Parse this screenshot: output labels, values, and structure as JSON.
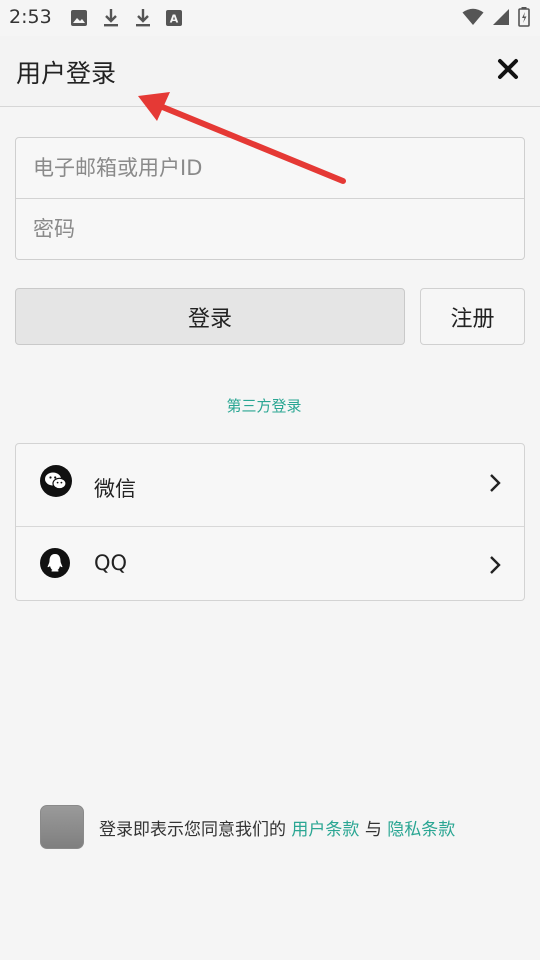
{
  "status_bar": {
    "time": "2:53",
    "left_icons": [
      "image-icon",
      "download-icon",
      "download-icon",
      "font-a-icon"
    ],
    "right_icons": [
      "wifi-icon",
      "signal-icon",
      "battery-icon"
    ]
  },
  "header": {
    "title": "用户登录",
    "close_icon": "close-icon"
  },
  "login_form": {
    "account_placeholder": "电子邮箱或用户ID",
    "password_placeholder": "密码",
    "account_value": "",
    "password_value": ""
  },
  "buttons": {
    "login_label": "登录",
    "register_label": "注册"
  },
  "third_party": {
    "title": "第三方登录",
    "items": [
      {
        "label": "微信",
        "icon": "wechat-icon"
      },
      {
        "label": "QQ",
        "icon": "qq-icon"
      }
    ]
  },
  "consent": {
    "checked": false,
    "prefix": "登录即表示您同意我们的",
    "terms_link": "用户条款",
    "connector": "与",
    "privacy_link": "隐私条款"
  },
  "colors": {
    "accent": "#2aa693",
    "annotation_arrow": "#e53935",
    "background": "#f5f5f5"
  }
}
